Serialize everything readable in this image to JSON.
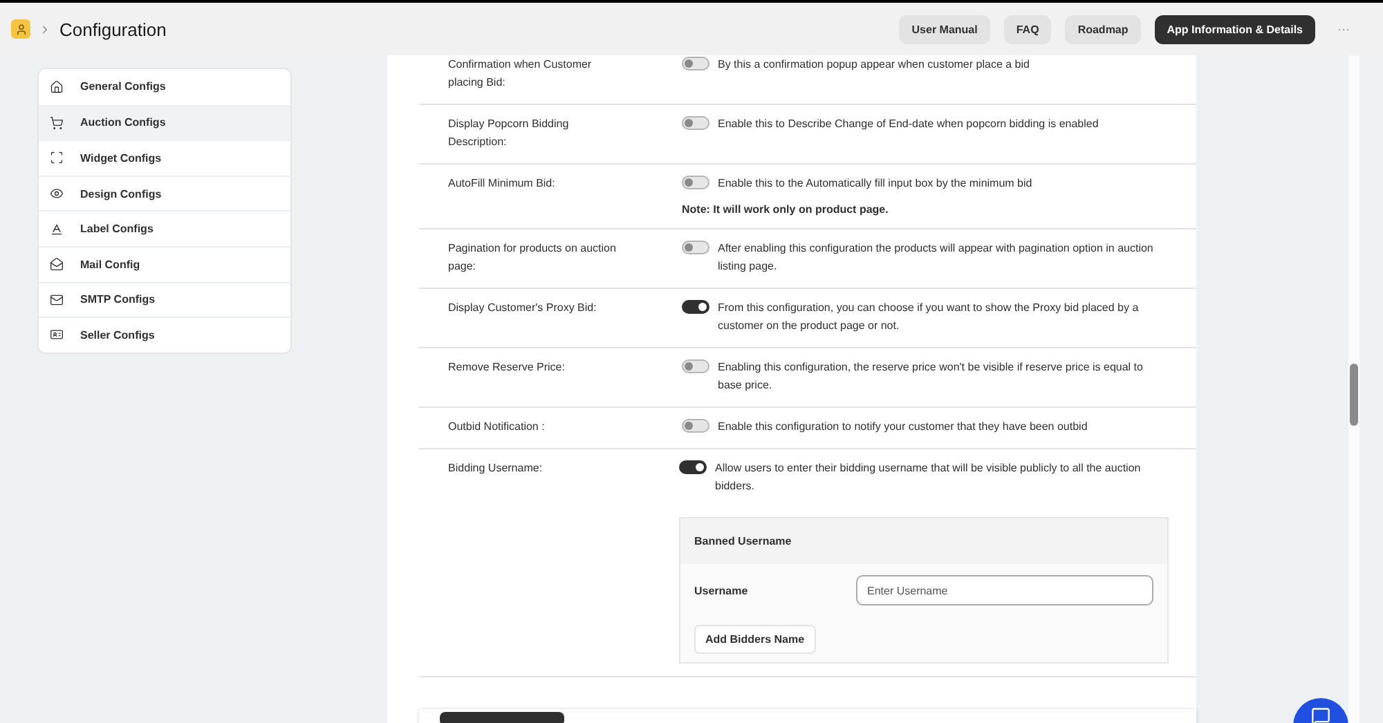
{
  "header": {
    "title": "Configuration",
    "buttons": [
      {
        "label": "User Manual",
        "primary": false
      },
      {
        "label": "FAQ",
        "primary": false
      },
      {
        "label": "Roadmap",
        "primary": false
      },
      {
        "label": "App Information & Details",
        "primary": true
      }
    ],
    "more": "···"
  },
  "sidebar": {
    "items": [
      {
        "label": "General Configs",
        "selected": false
      },
      {
        "label": "Auction Configs",
        "selected": true
      },
      {
        "label": "Widget Configs",
        "selected": false
      },
      {
        "label": "Design Configs",
        "selected": false
      },
      {
        "label": "Label Configs",
        "selected": false
      },
      {
        "label": "Mail Config",
        "selected": false
      },
      {
        "label": "SMTP Configs",
        "selected": false
      },
      {
        "label": "Seller Configs",
        "selected": false
      }
    ]
  },
  "settings": [
    {
      "label": "Confirmation when Customer placing Bid:",
      "on": false,
      "description": "By this a confirmation popup appear when customer place a bid"
    },
    {
      "label": "Display Popcorn Bidding Description:",
      "on": false,
      "description": "Enable this to Describe Change of End-date when popcorn bidding is enabled"
    },
    {
      "label": "AutoFill Minimum Bid:",
      "on": false,
      "description": "Enable this to the Automatically fill input box by the minimum bid",
      "note": "Note: It will work only on product page."
    },
    {
      "label": "Pagination for products on auction page:",
      "on": false,
      "description": "After enabling this configuration the products will appear with pagination option in auction listing page."
    },
    {
      "label": "Display Customer's Proxy Bid:",
      "on": true,
      "description": "From this configuration, you can choose if you want to show the Proxy bid placed by a customer on the product page or not."
    },
    {
      "label": "Remove Reserve Price:",
      "on": false,
      "description": "Enabling this configuration, the reserve price won't be visible if reserve price is equal to base price."
    },
    {
      "label": "Outbid Notification :",
      "on": false,
      "description": "Enable this configuration to notify your customer that they have been outbid"
    },
    {
      "label": "Bidding Username:",
      "on": true,
      "description": "Allow users to enter their bidding username that will be visible publicly to all the auction bidders.",
      "banned": {
        "title": "Banned Username",
        "field_label": "Username",
        "placeholder": "Enter Username",
        "button": "Add Bidders Name"
      }
    }
  ]
}
